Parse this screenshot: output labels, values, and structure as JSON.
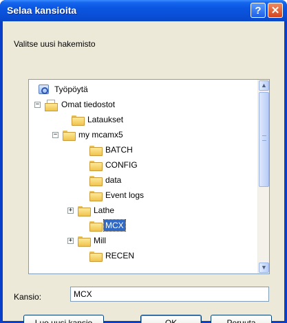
{
  "window": {
    "title": "Selaa kansioita",
    "help_glyph": "?",
    "close_glyph": "✕"
  },
  "instruction": "Valitse uusi hakemisto",
  "tree": {
    "nodes": [
      {
        "label": "Työpöytä",
        "icon": "desktop-icon",
        "expander": ""
      },
      {
        "label": "Omat tiedostot",
        "icon": "my-documents-icon",
        "expander": "−"
      },
      {
        "label": "Lataukset",
        "icon": "folder-icon",
        "expander": ""
      },
      {
        "label": "my mcamx5",
        "icon": "folder-icon",
        "expander": "−"
      },
      {
        "label": "BATCH",
        "icon": "folder-icon",
        "expander": ""
      },
      {
        "label": "CONFIG",
        "icon": "folder-icon",
        "expander": ""
      },
      {
        "label": "data",
        "icon": "folder-icon",
        "expander": ""
      },
      {
        "label": "Event logs",
        "icon": "folder-icon",
        "expander": ""
      },
      {
        "label": "Lathe",
        "icon": "folder-icon",
        "expander": "+"
      },
      {
        "label": "MCX",
        "icon": "folder-icon",
        "expander": "",
        "selected": true
      },
      {
        "label": "Mill",
        "icon": "folder-icon",
        "expander": "+"
      },
      {
        "label": "RECEN",
        "icon": "folder-icon",
        "expander": ""
      }
    ]
  },
  "folder_field": {
    "label": "Kansio:",
    "value": "MCX"
  },
  "buttons": {
    "new_folder": "Luo uusi kansio",
    "ok": "OK",
    "cancel": "Peruuta"
  }
}
